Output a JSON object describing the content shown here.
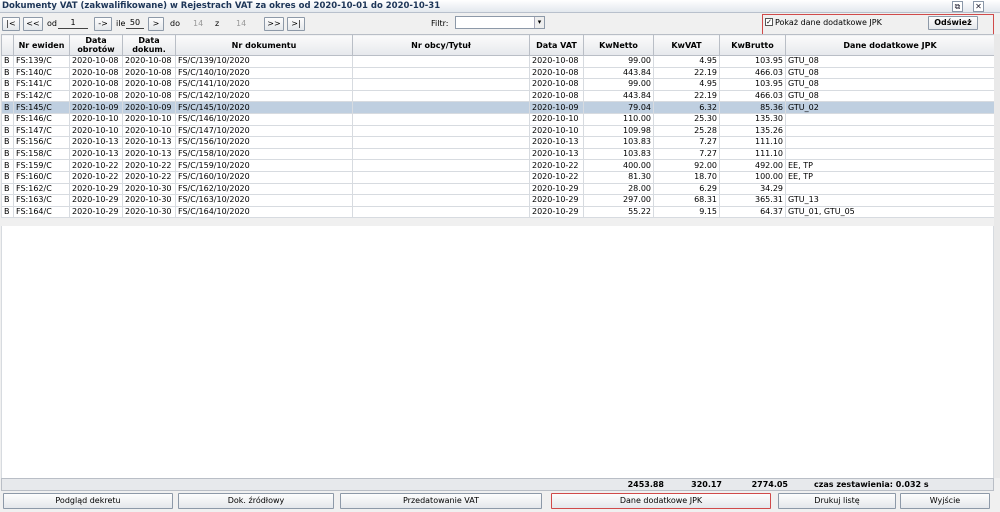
{
  "window": {
    "title": "Dokumenty VAT (zakwalifikowane) w Rejestrach VAT za okres od 2020-10-01 do 2020-10-31",
    "restore_icon": "restore-icon",
    "close_icon": "close-icon"
  },
  "pager": {
    "first": "|<",
    "prev": "<<",
    "od_label": "od",
    "od_value": "1",
    "go": "->",
    "ile_label": "ile",
    "ile_value": "50",
    "next_small": ">",
    "do_label": "do",
    "do_value": "14",
    "z_label": "z",
    "z_value": "14",
    "next": ">>",
    "last": ">|"
  },
  "filter": {
    "label": "Filtr:",
    "value": ""
  },
  "jpk": {
    "checkbox_label": "Pokaż dane dodatkowe JPK",
    "checked": true,
    "refresh": "Odśwież"
  },
  "columns": [
    "",
    "Nr ewiden",
    "Data obrotów",
    "Data dokum.",
    "Nr dokumentu",
    "Nr obcy/Tytuł",
    "Data VAT",
    "KwNetto",
    "KwVAT",
    "KwBrutto",
    "Dane dodatkowe JPK"
  ],
  "rows": [
    [
      "B",
      "FS:139/C",
      "2020-10-08",
      "2020-10-08",
      "FS/C/139/10/2020",
      "",
      "2020-10-08",
      "99.00",
      "4.95",
      "103.95",
      "GTU_08"
    ],
    [
      "B",
      "FS:140/C",
      "2020-10-08",
      "2020-10-08",
      "FS/C/140/10/2020",
      "",
      "2020-10-08",
      "443.84",
      "22.19",
      "466.03",
      "GTU_08"
    ],
    [
      "B",
      "FS:141/C",
      "2020-10-08",
      "2020-10-08",
      "FS/C/141/10/2020",
      "",
      "2020-10-08",
      "99.00",
      "4.95",
      "103.95",
      "GTU_08"
    ],
    [
      "B",
      "FS:142/C",
      "2020-10-08",
      "2020-10-08",
      "FS/C/142/10/2020",
      "",
      "2020-10-08",
      "443.84",
      "22.19",
      "466.03",
      "GTU_08"
    ],
    [
      "B",
      "FS:145/C",
      "2020-10-09",
      "2020-10-09",
      "FS/C/145/10/2020",
      "",
      "2020-10-09",
      "79.04",
      "6.32",
      "85.36",
      "GTU_02"
    ],
    [
      "B",
      "FS:146/C",
      "2020-10-10",
      "2020-10-10",
      "FS/C/146/10/2020",
      "",
      "2020-10-10",
      "110.00",
      "25.30",
      "135.30",
      ""
    ],
    [
      "B",
      "FS:147/C",
      "2020-10-10",
      "2020-10-10",
      "FS/C/147/10/2020",
      "",
      "2020-10-10",
      "109.98",
      "25.28",
      "135.26",
      ""
    ],
    [
      "B",
      "FS:156/C",
      "2020-10-13",
      "2020-10-13",
      "FS/C/156/10/2020",
      "",
      "2020-10-13",
      "103.83",
      "7.27",
      "111.10",
      ""
    ],
    [
      "B",
      "FS:158/C",
      "2020-10-13",
      "2020-10-13",
      "FS/C/158/10/2020",
      "",
      "2020-10-13",
      "103.83",
      "7.27",
      "111.10",
      ""
    ],
    [
      "B",
      "FS:159/C",
      "2020-10-22",
      "2020-10-22",
      "FS/C/159/10/2020",
      "",
      "2020-10-22",
      "400.00",
      "92.00",
      "492.00",
      "EE, TP"
    ],
    [
      "B",
      "FS:160/C",
      "2020-10-22",
      "2020-10-22",
      "FS/C/160/10/2020",
      "",
      "2020-10-22",
      "81.30",
      "18.70",
      "100.00",
      "EE, TP"
    ],
    [
      "B",
      "FS:162/C",
      "2020-10-29",
      "2020-10-30",
      "FS/C/162/10/2020",
      "",
      "2020-10-29",
      "28.00",
      "6.29",
      "34.29",
      ""
    ],
    [
      "B",
      "FS:163/C",
      "2020-10-29",
      "2020-10-30",
      "FS/C/163/10/2020",
      "",
      "2020-10-29",
      "297.00",
      "68.31",
      "365.31",
      "GTU_13"
    ],
    [
      "B",
      "FS:164/C",
      "2020-10-29",
      "2020-10-30",
      "FS/C/164/10/2020",
      "",
      "2020-10-29",
      "55.22",
      "9.15",
      "64.37",
      "GTU_01, GTU_05"
    ]
  ],
  "selected_row": 4,
  "totals": {
    "netto": "2453.88",
    "vat": "320.17",
    "brutto": "2774.05",
    "time": "czas zestawienia: 0.032 s"
  },
  "buttons": {
    "podglad": "Podgląd dekretu",
    "dok": "Dok. źródłowy",
    "przedat": "Przedatowanie VAT",
    "jpk": "Dane dodatkowe JPK",
    "drukuj": "Drukuj listę",
    "wyjscie": "Wyjście"
  }
}
